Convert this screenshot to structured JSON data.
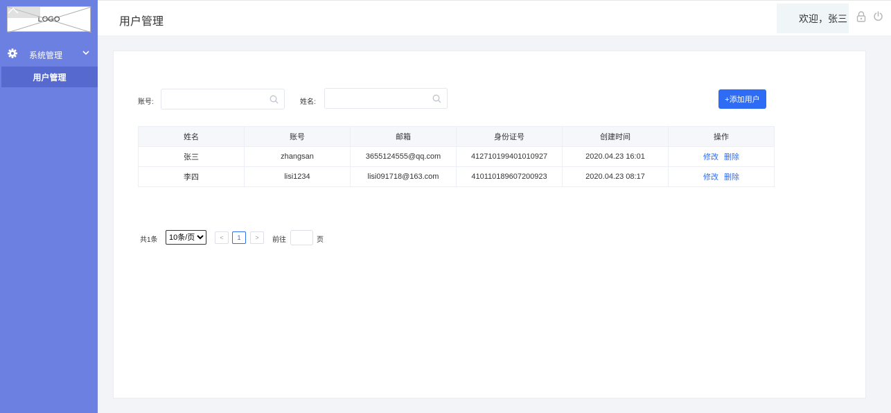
{
  "sidebar": {
    "logo_text": "LOGO",
    "group_label": "系统管理",
    "active_item": "用户管理"
  },
  "header": {
    "title": "用户管理",
    "welcome": "欢迎，张三"
  },
  "search": {
    "account_label": "账号:",
    "account_value": "",
    "name_label": "姓名:",
    "name_value": "",
    "add_button": "+添加用户"
  },
  "table": {
    "columns": [
      "姓名",
      "账号",
      "邮箱",
      "身份证号",
      "创建时间",
      "操作"
    ],
    "rows": [
      {
        "name": "张三",
        "account": "zhangsan",
        "email": "3655124555@qq.com",
        "id_number": "412710199401010927",
        "created": "2020.04.23 16:01",
        "edit": "修改",
        "delete": "删除"
      },
      {
        "name": "李四",
        "account": "lisi1234",
        "email": "lisi091718@163.com",
        "id_number": "410110189607200923",
        "created": "2020.04.23 08:17",
        "edit": "修改",
        "delete": "删除"
      }
    ]
  },
  "pagination": {
    "total": "共1条",
    "page_size": "10条/页",
    "prev": "<",
    "current": "1",
    "next": ">",
    "goto_label": "前往",
    "goto_value": "",
    "goto_suffix": "页"
  },
  "colors": {
    "sidebar_bg": "#6b80e0",
    "sidebar_active": "#5569cf",
    "primary": "#2f6cf5",
    "page_bg": "#f3f4f8"
  }
}
